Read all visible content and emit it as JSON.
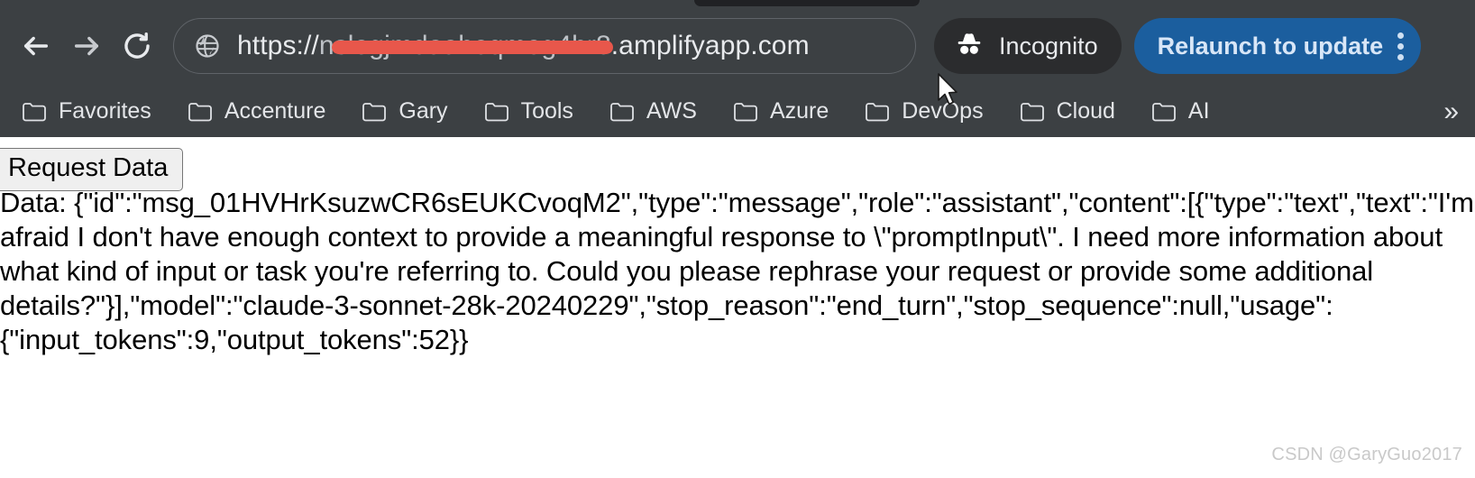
{
  "browser": {
    "nav": {
      "back_label": "Back",
      "forward_label": "Forward",
      "reload_label": "Reload"
    },
    "omnibox": {
      "site_icon": "globe-icon",
      "scheme_text": "https://",
      "redacted_host_text": "nslogjmdaaheqmeg4hr8",
      "url_tail_text": ".amplifyapp.com",
      "redaction_color": "#e8574b"
    },
    "incognito": {
      "label": "Incognito",
      "icon": "incognito-hat-icon"
    },
    "relaunch": {
      "label": "Relaunch to update",
      "menu_icon": "three-dot-menu-icon",
      "accent_color": "#1b5e9e"
    },
    "bookmarks": {
      "items": [
        {
          "label": "Favorites",
          "icon": "folder-icon"
        },
        {
          "label": "Accenture",
          "icon": "folder-icon"
        },
        {
          "label": "Gary",
          "icon": "folder-icon"
        },
        {
          "label": "Tools",
          "icon": "folder-icon"
        },
        {
          "label": "AWS",
          "icon": "folder-icon"
        },
        {
          "label": "Azure",
          "icon": "folder-icon"
        },
        {
          "label": "DevOps",
          "icon": "folder-icon"
        },
        {
          "label": "Cloud",
          "icon": "folder-icon"
        },
        {
          "label": "AI",
          "icon": "folder-icon"
        }
      ],
      "overflow_label": "»"
    },
    "cursor": {
      "icon": "mouse-pointer-icon",
      "over_item": "DevOps"
    }
  },
  "page": {
    "request_button_label": "Request Data",
    "response_text": "Data: {\"id\":\"msg_01HVHrKsuzwCR6sEUKCvoqM2\",\"type\":\"message\",\"role\":\"assistant\",\"content\":[{\"type\":\"text\",\"text\":\"I'm afraid I don't have enough context to provide a meaningful response to \\\"promptInput\\\". I need more information about what kind of input or task you're referring to. Could you please rephrase your request or provide some additional details?\"}],\"model\":\"claude-3-sonnet-28k-20240229\",\"stop_reason\":\"end_turn\",\"stop_sequence\":null,\"usage\":{\"input_tokens\":9,\"output_tokens\":52}}",
    "watermark": "CSDN @GaryGuo2017"
  }
}
